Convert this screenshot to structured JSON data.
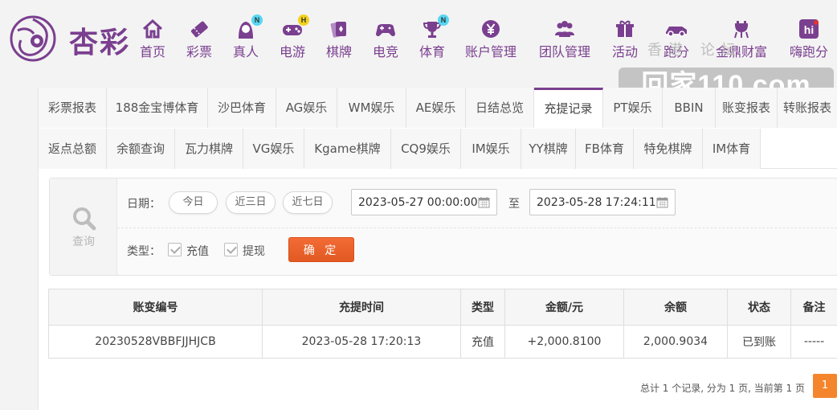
{
  "brand": {
    "name": "杏彩"
  },
  "nav": [
    {
      "label": "首页",
      "icon": "home-icon"
    },
    {
      "label": "彩票",
      "icon": "lottery-ticket-icon"
    },
    {
      "label": "真人",
      "icon": "live-dealer-icon",
      "badge": "N"
    },
    {
      "label": "电游",
      "icon": "gamepad-icon",
      "badge": "H"
    },
    {
      "label": "棋牌",
      "icon": "cards-icon"
    },
    {
      "label": "电竞",
      "icon": "esports-controller-icon"
    },
    {
      "label": "体育",
      "icon": "trophy-icon",
      "badge": "N"
    },
    {
      "label": "账户管理",
      "icon": "yen-coin-icon"
    },
    {
      "label": "团队管理",
      "icon": "team-icon"
    },
    {
      "label": "活动",
      "icon": "gift-icon"
    },
    {
      "label": "跑分",
      "icon": "car-icon"
    },
    {
      "label": "金鼎财富",
      "icon": "tripod-icon"
    },
    {
      "label": "嗨跑分",
      "icon": "hi-icon"
    }
  ],
  "watermark": {
    "top": "香港  论坛",
    "main": "回家110.com"
  },
  "tabs_row1": [
    "彩票报表",
    "188金宝博体育",
    "沙巴体育",
    "AG娱乐",
    "WM娱乐",
    "AE娱乐",
    "日结总览",
    "充提记录",
    "PT娱乐",
    "BBIN",
    "账变报表",
    "转账报表"
  ],
  "tabs_row2": [
    "返点总额",
    "余额查询",
    "瓦力棋牌",
    "VG娱乐",
    "Kgame棋牌",
    "CQ9娱乐",
    "IM娱乐",
    "YY棋牌",
    "FB体育",
    "特免棋牌",
    "IM体育"
  ],
  "active_tab": "充提记录",
  "query": {
    "side_label": "查询",
    "date_label": "日期：",
    "quick_ranges": [
      "今日",
      "近三日",
      "近七日"
    ],
    "start": "2023-05-27 00:00:00",
    "to_label": "至",
    "end": "2023-05-28 17:24:11",
    "type_label": "类型：",
    "types": [
      "充值",
      "提现"
    ],
    "confirm": "确 定"
  },
  "table": {
    "headers": [
      "账变编号",
      "充提时间",
      "类型",
      "金额/元",
      "余额",
      "状态",
      "备注"
    ],
    "rows": [
      [
        "20230528VBBFJJHJCB",
        "2023-05-28 17:20:13",
        "充值",
        "+2,000.8100",
        "2,000.9034",
        "已到账",
        "-----"
      ]
    ]
  },
  "pager": {
    "info": "总计 1 个记录, 分为 1 页, 当前第 1 页",
    "current": "1"
  },
  "colors": {
    "brand": "#7a3f8f",
    "confirm": "#e85f27",
    "amount": "#e01f1f",
    "status_ok": "#2f9a2f",
    "page": "#f5852c"
  }
}
